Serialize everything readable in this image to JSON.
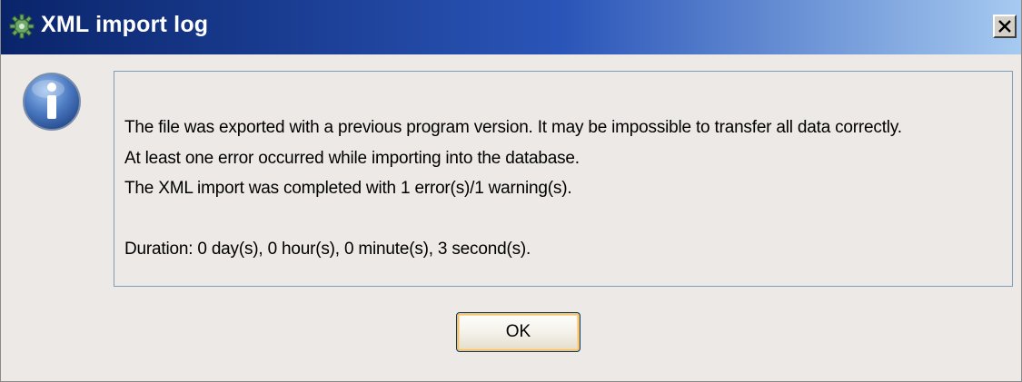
{
  "window": {
    "title": "XML import log"
  },
  "icons": {
    "app": "gear-app-icon",
    "message": "information-icon",
    "close": "close-icon"
  },
  "message": {
    "lines": [
      "The file was exported with a previous program version. It may be impossible to transfer all data correctly.",
      "At least one error occurred while importing into the database.",
      "The XML import was completed with 1 error(s)/1 warning(s).",
      "Duration: 0 day(s), 0 hour(s), 0 minute(s), 3 second(s)."
    ]
  },
  "buttons": {
    "ok_label": "OK"
  },
  "colors": {
    "titlebar_start": "#0a246a",
    "titlebar_end": "#a6caf0",
    "dialog_background": "#ece9e6",
    "ok_button_highlight": "#f7c26a",
    "info_icon": "#4a78c0"
  }
}
